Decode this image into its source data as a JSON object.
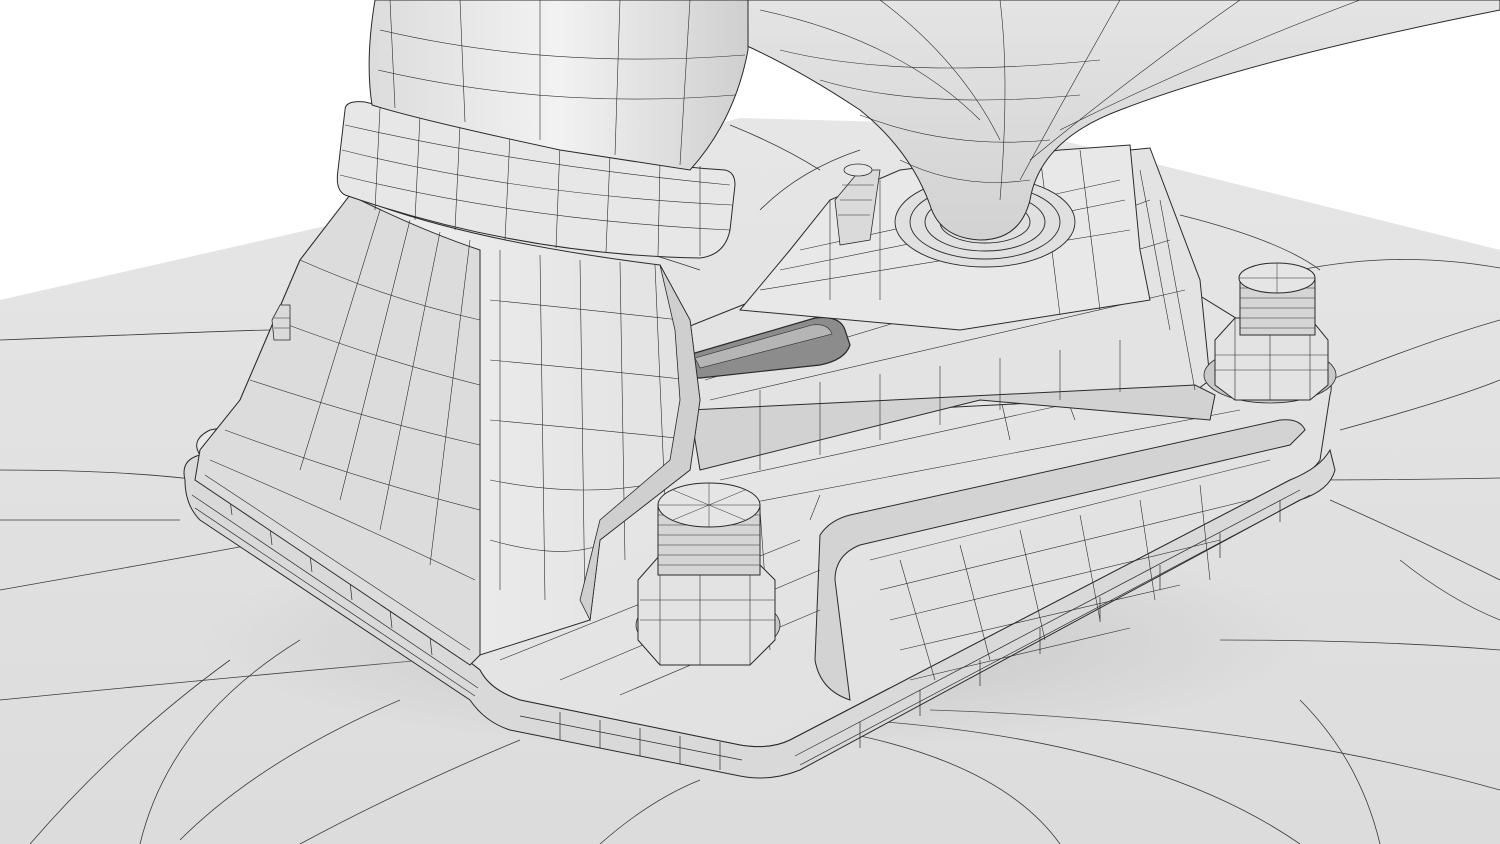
{
  "scene": {
    "subject": "wireframe-render",
    "colors": {
      "background": "#ffffff",
      "floor": "#e3e3e3",
      "floor_shade": "#d6d6d6",
      "surface_light": "#eeeeee",
      "surface_mid": "#dedede",
      "surface_dark": "#c4c4c4",
      "wire": "#2a2a2a",
      "shadow": "#a9a9a9"
    }
  }
}
